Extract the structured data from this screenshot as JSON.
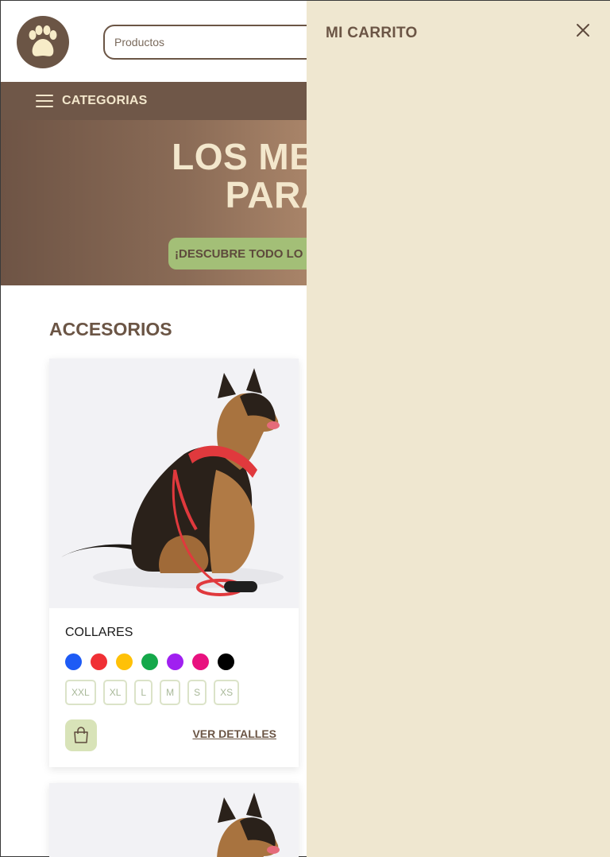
{
  "header": {
    "logo_icon": "paw-icon",
    "search": {
      "placeholder": "Productos",
      "value": ""
    }
  },
  "nav": {
    "menu_icon": "hamburger-icon",
    "categories_label": "CATEGORIAS"
  },
  "hero": {
    "title_line1": "LOS MEJORES",
    "title_line2": "PARA TU",
    "cta_label": "¡DESCUBRE TODO LO Q"
  },
  "main": {
    "section_title": "ACCESORIOS",
    "products": [
      {
        "name": "COLLARES",
        "colors": [
          "#1e5bf5",
          "#f03035",
          "#ffc107",
          "#14a84a",
          "#a020f0",
          "#e8117f",
          "#000000"
        ],
        "sizes": [
          "XXL",
          "XL",
          "L",
          "M",
          "S",
          "XS"
        ],
        "cart_icon": "shopping-bag-icon",
        "details_label": "VER DETALLES"
      }
    ]
  },
  "cart": {
    "title": "MI CARRITO",
    "close_icon": "close-icon"
  },
  "colors": {
    "brand_brown": "#6b5545",
    "cream": "#f3e7cc",
    "drawer_bg": "#efe7d0",
    "accent_green": "#a3bf77"
  }
}
